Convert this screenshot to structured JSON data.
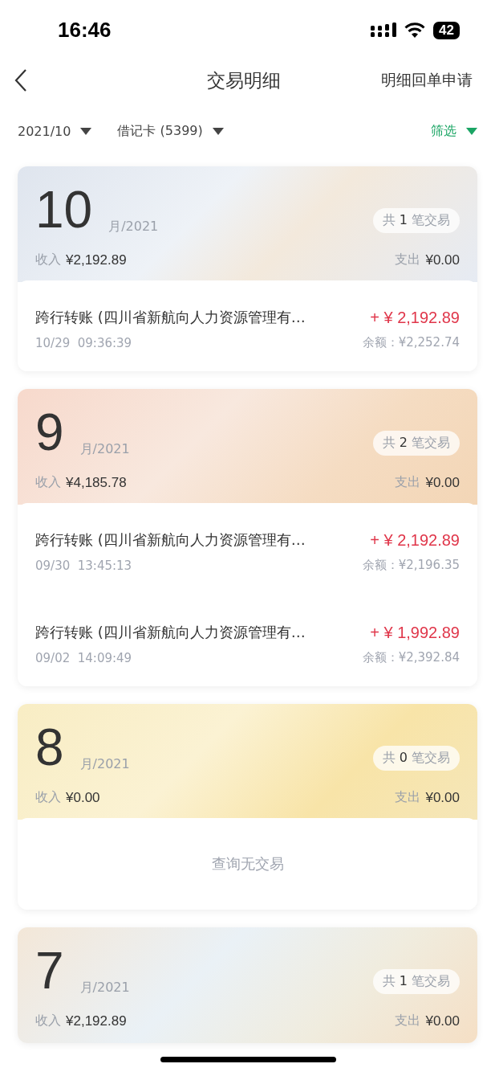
{
  "status_bar": {
    "time": "16:46",
    "battery": "42"
  },
  "nav": {
    "title": "交易明细",
    "action": "明细回单申请"
  },
  "filters": [
    {
      "label": "2021/10",
      "kind": "dropdown"
    },
    {
      "label": "借记卡 (5399)",
      "kind": "dropdown"
    },
    {
      "label": "筛选",
      "kind": "filter"
    }
  ],
  "months": [
    {
      "month": "10",
      "suffix": "月/2021",
      "count": "共 **1** 笔交易",
      "income_label": "收入",
      "income": "¥2,192.89",
      "expense_label": "支出",
      "expense": "¥0.00",
      "transactions": [
        {
          "description": "跨行转账 (四川省新航向人力资源管理有…",
          "amount": "+ ¥ 2,192.89",
          "datetime": "10/29  09:36:39",
          "balance": "余额：¥2,252.74"
        }
      ]
    },
    {
      "month": "9",
      "suffix": "月/2021",
      "count": "共 **2** 笔交易",
      "income_label": "收入",
      "income": "¥4,185.78",
      "expense_label": "支出",
      "expense": "¥0.00",
      "transactions": [
        {
          "description": "跨行转账 (四川省新航向人力资源管理有…",
          "amount": "+ ¥ 2,192.89",
          "datetime": "09/30  13:45:13",
          "balance": "余额：¥2,196.35"
        },
        {
          "description": "跨行转账 (四川省新航向人力资源管理有…",
          "amount": "+ ¥ 1,992.89",
          "datetime": "09/02  14:09:49",
          "balance": "余额：¥2,392.84"
        }
      ]
    },
    {
      "month": "8",
      "suffix": "月/2021",
      "count": "共 **0** 笔交易",
      "income_label": "收入",
      "income": "¥0.00",
      "expense_label": "支出",
      "expense": "¥0.00",
      "empty_text": "查询无交易"
    },
    {
      "month": "7",
      "suffix": "月/2021",
      "count": "共 **1** 笔交易",
      "income_label": "收入",
      "income": "¥2,192.89",
      "expense_label": "支出",
      "expense": "¥0.00"
    }
  ]
}
